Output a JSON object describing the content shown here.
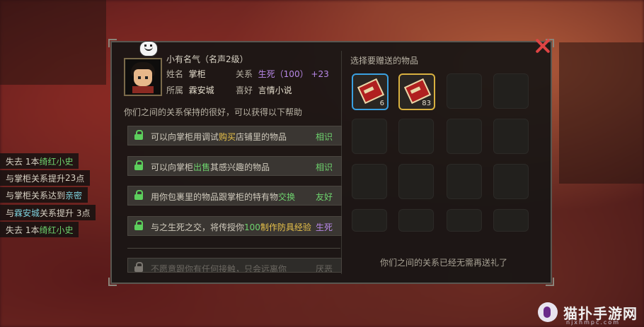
{
  "npc": {
    "fame": "小有名气（名声2级）",
    "name_label": "姓名",
    "name": "掌柜",
    "affiliation_label": "所属",
    "affiliation": "霖安城",
    "relation_label": "关系",
    "relation_level": "生死",
    "relation_points": "（100）",
    "relation_delta": "+23",
    "hobby_label": "喜好",
    "hobby": "言情小说"
  },
  "help_text": "你们之间的关系保持的很好，可以获得以下帮助",
  "help_rows": [
    {
      "pre": "可以向掌柜用调试",
      "hl": "购买",
      "post": "店铺里的物品",
      "level": "相识"
    },
    {
      "pre": "可以向掌柜",
      "hl": "出售",
      "post": "其感兴趣的物品",
      "level": "相识"
    },
    {
      "pre": "用你包裹里的物品跟掌柜的特有物",
      "hl": "交换",
      "post": "",
      "level": "友好"
    },
    {
      "pre": "与之生死之交，将传授你",
      "hl": "100",
      "post": "制作防具经验",
      "level": "生死"
    },
    {
      "pre": "不愿意跟你有任何接触，只会远离你",
      "hl": "",
      "post": "",
      "level": "厌恶"
    }
  ],
  "gift": {
    "title": "选择要赠送的物品",
    "items": [
      {
        "icon": "red-book-icon",
        "count": "6"
      },
      {
        "icon": "red-book-icon",
        "count": "83"
      }
    ],
    "message": "你们之间的关系已经无需再送礼了"
  },
  "log": [
    {
      "a": "失去 1本",
      "b": "绮红小史",
      "c": ""
    },
    {
      "a": "与掌柜关系提升",
      "b": "23",
      "c": "点"
    },
    {
      "a": "与掌柜关系达到",
      "b": "亲密",
      "c": ""
    },
    {
      "a": "与",
      "b": "霖安城",
      "c": "关系提升 3点"
    },
    {
      "a": "失去 1本",
      "b": "绮红小史",
      "c": ""
    }
  ],
  "watermark": {
    "title": "猫扑手游网",
    "url": "njxhmpc.com"
  },
  "colors": {
    "relation": "#b888e8",
    "highlight": "#6ed36e",
    "selected_slot": "#d8b040",
    "close": "#dd4444"
  }
}
